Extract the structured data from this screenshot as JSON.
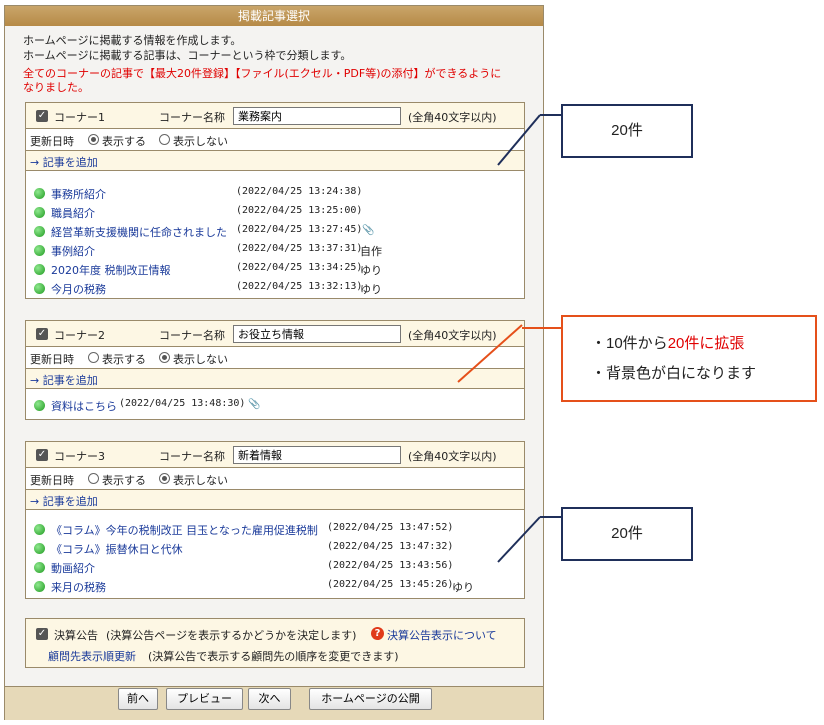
{
  "title": "掲載記事選択",
  "intro": {
    "line1": "ホームページに掲載する情報を作成します。",
    "line2": "ホームページに掲載する記事は、コーナーという枠で分類します。",
    "line3": "全てのコーナーの記事で【最大20件登録】【ファイル(エクセル・PDF等)の添付】ができるように",
    "line4": "なりました。"
  },
  "corners": [
    {
      "label": "コーナー1",
      "name_label": "コーナー名称",
      "name_value": "業務案内",
      "limit": "(全角40文字以内)",
      "update_label": "更新日時",
      "show": "表示する",
      "hide": "表示しない",
      "add": "→ 記事を追加",
      "articles": [
        {
          "title": "事務所紹介",
          "date": "(2022/04/25 13:24:38)",
          "author": ""
        },
        {
          "title": "職員紹介",
          "date": "(2022/04/25 13:25:00)",
          "author": ""
        },
        {
          "title": "経営革新支援機関に任命されました",
          "date": "(2022/04/25 13:27:45)",
          "author": ""
        },
        {
          "title": "事例紹介",
          "date": "(2022/04/25 13:37:31)",
          "author": "自作"
        },
        {
          "title": "2020年度 税制改正情報",
          "date": "(2022/04/25 13:34:25)",
          "author": "ゆり"
        },
        {
          "title": "今月の税務",
          "date": "(2022/04/25 13:32:13)",
          "author": "ゆり"
        }
      ]
    },
    {
      "label": "コーナー2",
      "name_label": "コーナー名称",
      "name_value": "お役立ち情報",
      "limit": "(全角40文字以内)",
      "update_label": "更新日時",
      "show": "表示する",
      "hide": "表示しない",
      "add": "→ 記事を追加",
      "articles": [
        {
          "title": "資料はこちら",
          "date": "(2022/04/25 13:48:30)",
          "author": ""
        }
      ]
    },
    {
      "label": "コーナー3",
      "name_label": "コーナー名称",
      "name_value": "新着情報",
      "limit": "(全角40文字以内)",
      "update_label": "更新日時",
      "show": "表示する",
      "hide": "表示しない",
      "add": "→ 記事を追加",
      "articles": [
        {
          "title": "《コラム》今年の税制改正 目玉となった雇用促進税制",
          "date": "(2022/04/25 13:47:52)",
          "author": ""
        },
        {
          "title": "《コラム》振替休日と代休",
          "date": "(2022/04/25 13:47:32)",
          "author": ""
        },
        {
          "title": "動画紹介",
          "date": "(2022/04/25 13:43:56)",
          "author": ""
        },
        {
          "title": "来月の税務",
          "date": "(2022/04/25 13:45:26)",
          "author": "ゆり"
        }
      ]
    }
  ],
  "settlement": {
    "label": "決算公告",
    "desc": "(決算公告ページを表示するかどうかを決定します)",
    "help": "決算公告表示について",
    "order_link": "顧問先表示順更新",
    "order_desc": "(決算公告で表示する顧問先の順序を変更できます)"
  },
  "buttons": {
    "prev": "前へ",
    "preview": "プレビュー",
    "next": "次へ",
    "publish": "ホームページの公開"
  },
  "notes": {
    "n1": "20件",
    "n2a": "・10件から",
    "n2b": "20件に拡張",
    "n2c": "・背景色が白になります",
    "n3": "20件"
  },
  "colors": {
    "accent_red": "#e00000",
    "link": "#1a3a9a",
    "note_orange": "#e5501a",
    "note_navy": "#1f2f5a"
  }
}
